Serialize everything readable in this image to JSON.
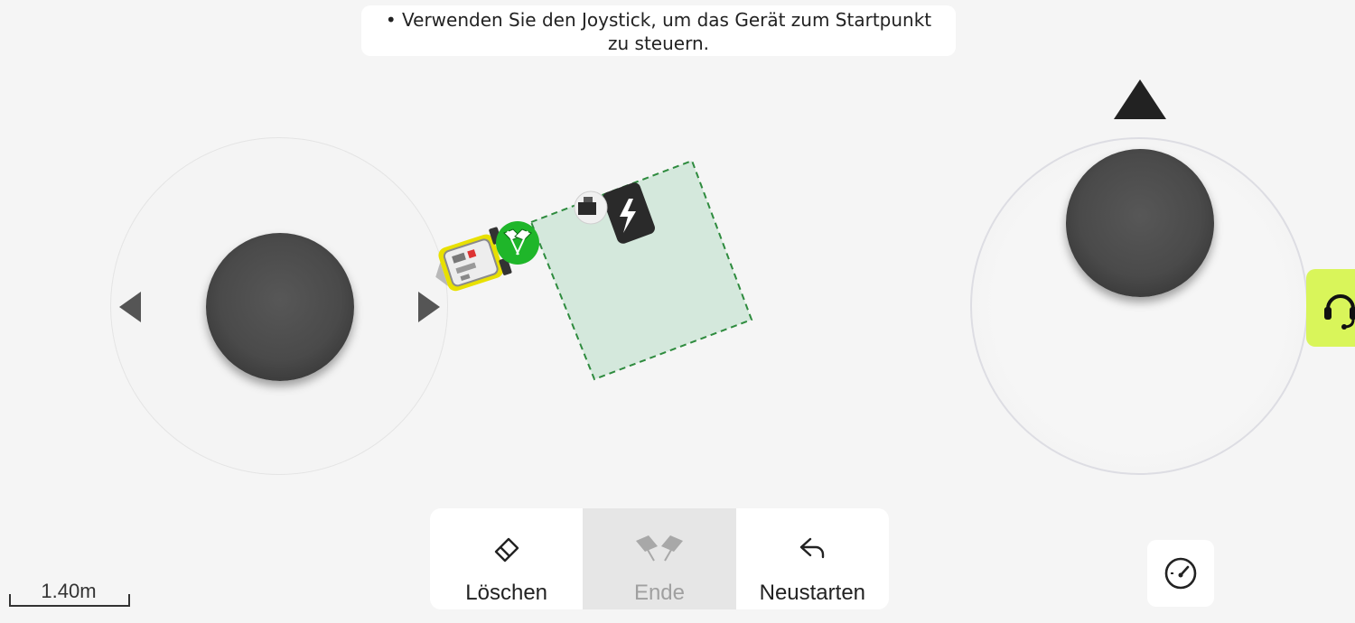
{
  "instruction": {
    "line1": "• Verwenden Sie den Joystick, um das Gerät zum Startpunkt",
    "line2": "zu steuern."
  },
  "joysticks": {
    "left": {
      "icon_left": "triangle-left-icon",
      "icon_right": "triangle-right-icon"
    },
    "right": {
      "icon_up": "triangle-up-icon"
    }
  },
  "map": {
    "zone_fill": "#d4e8dc",
    "zone_border": "#2e8b3e",
    "start_marker_color": "#1fb62a",
    "icons": [
      "mower-icon",
      "checkered-flags-icon",
      "charging-station-icon"
    ]
  },
  "toolbar": {
    "delete_label": "Löschen",
    "end_label": "Ende",
    "restart_label": "Neustarten"
  },
  "scale": {
    "label": "1.40m"
  },
  "support": {
    "icon": "headset-icon",
    "color": "#d9f55a"
  },
  "speed": {
    "icon": "speedometer-icon"
  }
}
